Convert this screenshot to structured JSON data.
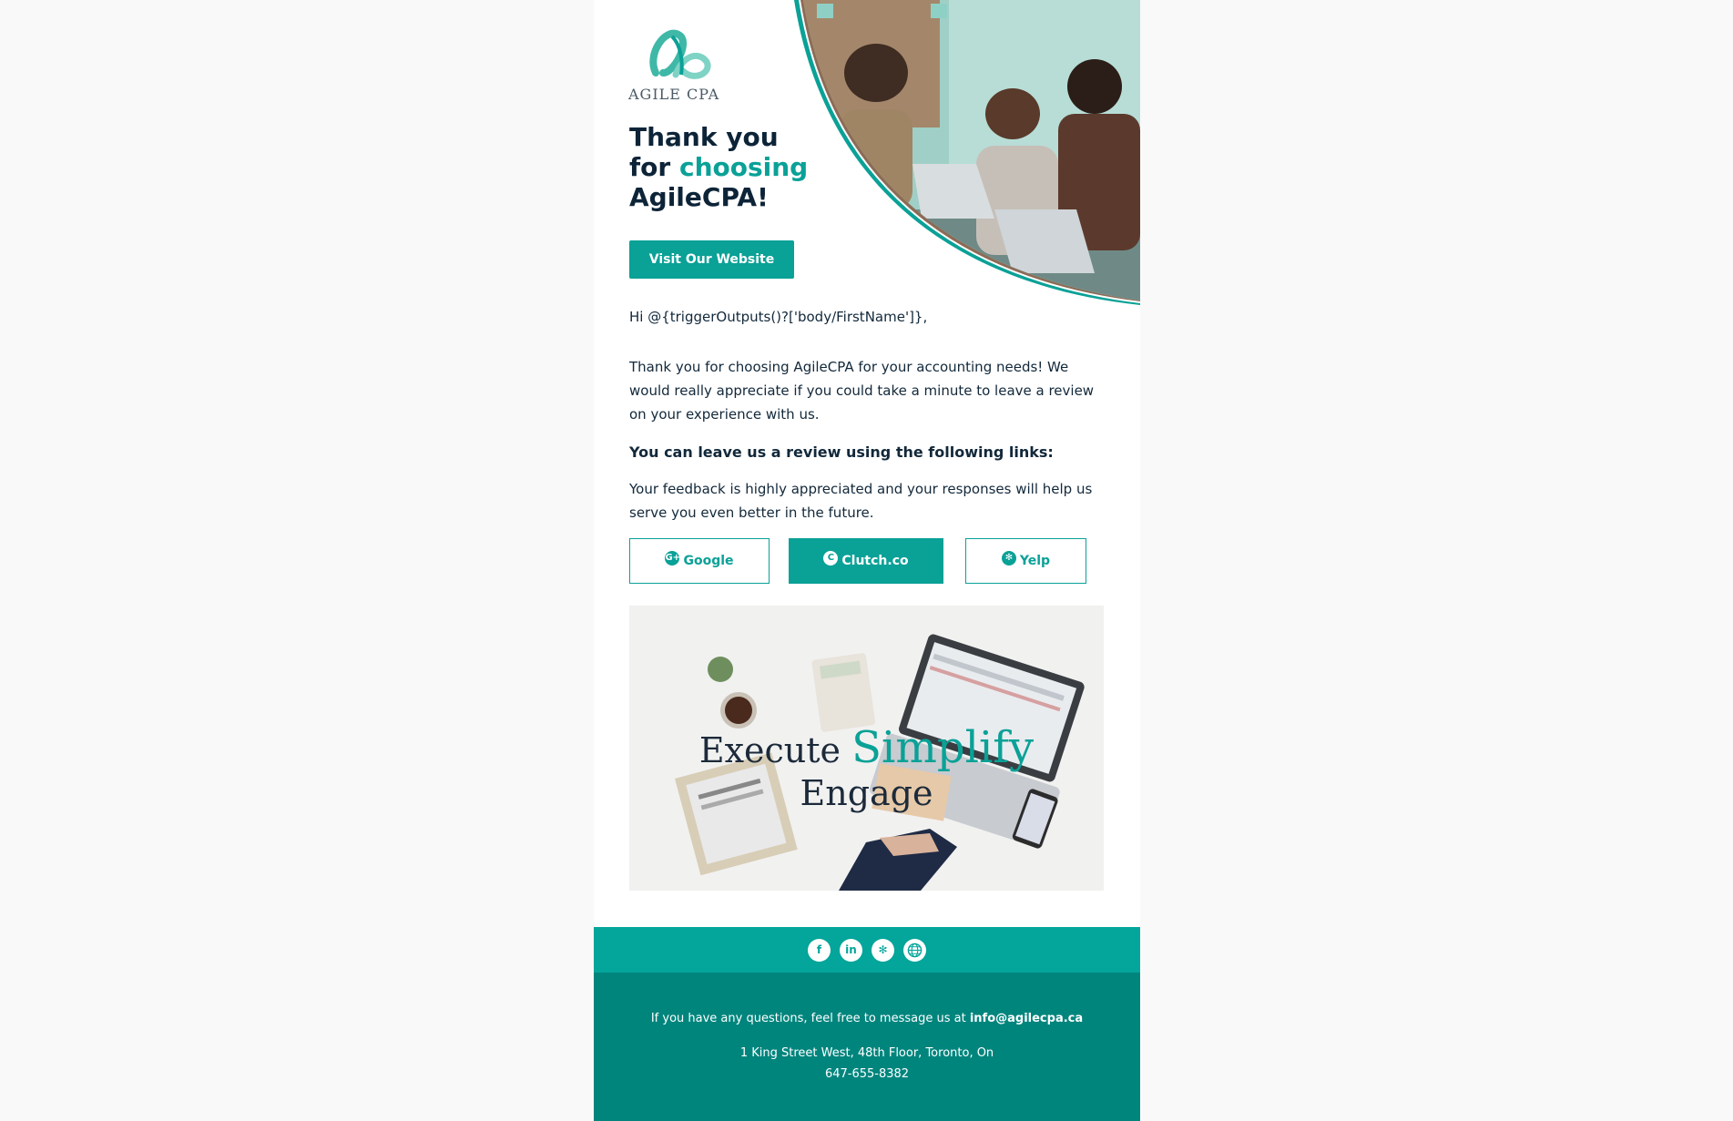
{
  "brand": {
    "logo_text": "AGILE CPA",
    "accent_color": "#0aa197",
    "dark_color": "#0d2438"
  },
  "hero": {
    "headline_line1": "Thank you",
    "headline_for": "for ",
    "headline_accent": "choosing",
    "headline_line3": "AgileCPA!",
    "cta_label": "Visit Our Website"
  },
  "body": {
    "greeting": "Hi @{triggerOutputs()?['body/FirstName']},",
    "paragraph": "Thank you for choosing AgileCPA for your accounting needs! We would really appreciate if you could take a minute to leave a review on your experience with us.",
    "review_heading": "You can leave us a review using the following links:",
    "feedback": "Your feedback is highly appreciated and your responses will help us serve you even better in the future."
  },
  "review_buttons": [
    {
      "label": "Google",
      "icon": "google-plus-icon"
    },
    {
      "label": "Clutch.co",
      "icon": "clutch-icon"
    },
    {
      "label": "Yelp",
      "icon": "yelp-icon"
    }
  ],
  "banner": {
    "word1": "Execute",
    "word2": "Simplify",
    "word3": "Engage"
  },
  "social_icons": [
    "facebook-icon",
    "linkedin-icon",
    "yelp-icon",
    "globe-icon"
  ],
  "footer": {
    "question_prefix": "If you have any questions, feel free to message us at ",
    "email": "info@agilecpa.ca",
    "address": "1 King Street West, 48th Floor, Toronto, On",
    "phone": "647-655-8382"
  }
}
